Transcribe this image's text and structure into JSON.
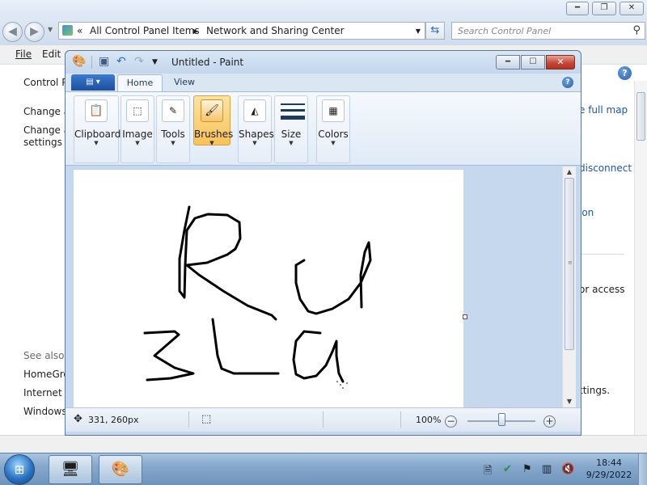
{
  "explorer": {
    "address": {
      "overflow": "«",
      "crumbs": [
        "All Control Panel Items",
        "Network and Sharing Center"
      ],
      "separator": "▶"
    },
    "search_placeholder": "Search Control Panel",
    "menu": [
      "File",
      "Edit"
    ],
    "nav": [
      "Control P",
      "Change a",
      "Change a",
      "settings",
      "See also",
      "HomeGro",
      "Internet C",
      "Windows"
    ],
    "right_links": [
      "e full map",
      "disconnect",
      "ion",
      "or access",
      "ttings."
    ]
  },
  "paint": {
    "title": "Untitled - Paint",
    "tabs": [
      "Home",
      "View"
    ],
    "ribbon_groups": [
      "Clipboard",
      "Image",
      "Tools",
      "Brushes",
      "Shapes",
      "Size",
      "Colors"
    ],
    "selected_group": "Brushes",
    "status": {
      "position": "331, 260px",
      "zoom": "100%"
    },
    "zoom_level_fraction": 0.5
  },
  "taskbar": {
    "time": "18:44",
    "date": "9/29/2022"
  }
}
